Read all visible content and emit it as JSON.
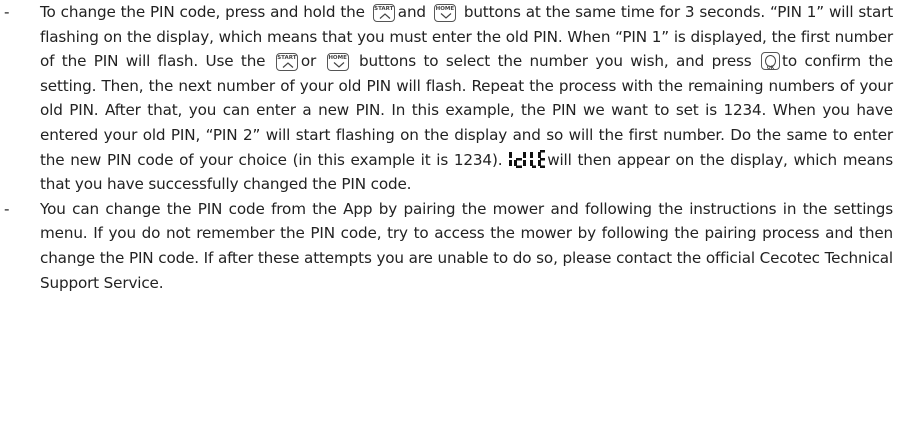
{
  "bullet_char": "-",
  "icons": {
    "start_key": {
      "name": "start-button-icon",
      "label": "START"
    },
    "home_key": {
      "name": "home-button-icon",
      "label": "HOME"
    },
    "ok_key": {
      "name": "ok-button-icon",
      "label": "OK"
    },
    "display": {
      "name": "idle-display-icon",
      "reads": "IdLE"
    }
  },
  "paragraph_1": {
    "t1": "To change the PIN code, press and hold the",
    "t2": "and",
    "t3": "buttons at the same time for 3 seconds. “PIN 1” will start flashing on the display, which means that you must enter the old PIN. When “PIN 1” is displayed, the first number of the PIN will flash. Use the",
    "t4": "or",
    "t5": "buttons to select the number you wish, and press",
    "t6": "to confirm the setting. Then, the next number of your old PIN will flash. Repeat the process with the remaining numbers of your old PIN. After that, you can enter a new PIN. In this example, the PIN we want to set is 1234. When you have entered your old PIN, “PIN 2” will start flashing on the display and so will the first number. Do the same to enter the new PIN code of your choice (in this example it is 1234).",
    "t7": "will then appear on the display, which means that you have successfully changed the PIN code."
  },
  "paragraph_2": {
    "text": "You can change the PIN code from the App by pairing the mower and following the instructions in the settings menu. If you do not remember the PIN code, try to access the mower by following the pairing process and then change the PIN code. If after these attempts you are unable to do so, please contact the official Cecotec Technical Support Service."
  }
}
